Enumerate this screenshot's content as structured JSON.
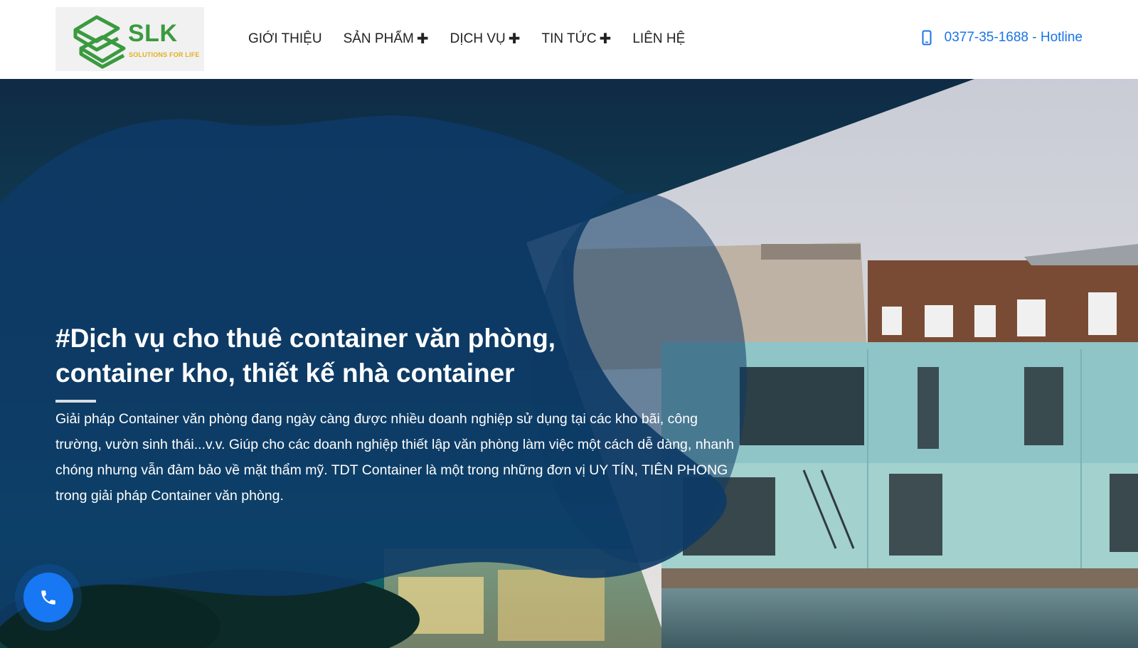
{
  "logo": {
    "name": "SLK",
    "tagline": "SOLUTIONS FOR LIFE"
  },
  "nav": {
    "items": [
      {
        "label": "GIỚI THIỆU",
        "has_submenu": false
      },
      {
        "label": "SẢN PHẨM",
        "has_submenu": true
      },
      {
        "label": "DỊCH VỤ",
        "has_submenu": true
      },
      {
        "label": "TIN TỨC",
        "has_submenu": true
      },
      {
        "label": "LIÊN HỆ",
        "has_submenu": false
      }
    ],
    "submenu_symbol": "✚"
  },
  "hotline": {
    "label": "0377-35-1688 - Hotline",
    "icon": "mobile-phone-icon"
  },
  "hero": {
    "title": "#Dịch vụ cho thuê container văn phòng, container kho, thiết kế nhà container",
    "description": "Giải pháp Container văn phòng đang ngày càng được nhiều doanh nghiệp sử dụng tại các kho bãi, công trường, vườn sinh thái...v.v. Giúp cho các doanh nghiệp thiết lập văn phòng làm việc một cách dễ dàng, nhanh chóng nhưng vẫn đảm bảo về mặt thẩm mỹ. TDT Container là một trong những đơn vị UY TÍN, TIÊN PHONG trong giải pháp Container văn phòng."
  },
  "call_button": {
    "icon": "phone-icon"
  },
  "colors": {
    "accent": "#1a73e8",
    "hero_overlay": "#0d3a66",
    "logo_green": "#3a9a3f",
    "call_button": "#1877f2"
  }
}
